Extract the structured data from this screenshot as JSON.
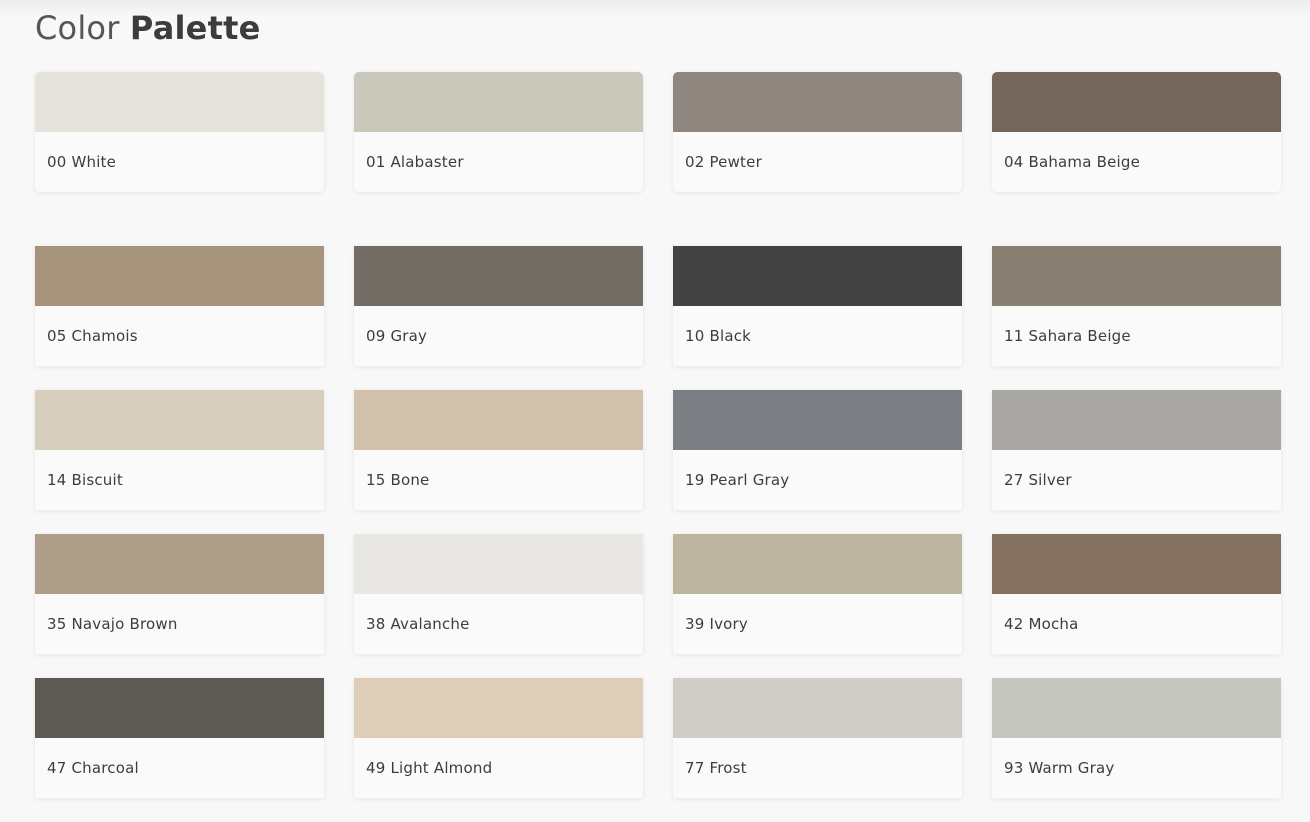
{
  "header": {
    "title_light": "Color",
    "title_bold": "Palette"
  },
  "colors": [
    {
      "label": "00 White",
      "hex": "#e5e3dc"
    },
    {
      "label": "01 Alabaster",
      "hex": "#cac8bb"
    },
    {
      "label": "02 Pewter",
      "hex": "#8f8680"
    },
    {
      "label": "04 Bahama Beige",
      "hex": "#74665b"
    },
    {
      "label": "05 Chamois",
      "hex": "#a6937b"
    },
    {
      "label": "09 Gray",
      "hex": "#736d66"
    },
    {
      "label": "10 Black",
      "hex": "#434343"
    },
    {
      "label": "11 Sahara Beige",
      "hex": "#897e72"
    },
    {
      "label": "14 Biscuit",
      "hex": "#d7cebd"
    },
    {
      "label": "15 Bone",
      "hex": "#d2c2ad"
    },
    {
      "label": "19 Pearl Gray",
      "hex": "#7b7f83"
    },
    {
      "label": "27 Silver",
      "hex": "#a8a7a3"
    },
    {
      "label": "35 Navajo Brown",
      "hex": "#ae9e89"
    },
    {
      "label": "38 Avalanche",
      "hex": "#e8e7e3"
    },
    {
      "label": "39 Ivory",
      "hex": "#bdb49f"
    },
    {
      "label": "42 Mocha",
      "hex": "#857160"
    },
    {
      "label": "47 Charcoal",
      "hex": "#5d5953"
    },
    {
      "label": "49 Light Almond",
      "hex": "#ddcdb9"
    },
    {
      "label": "77 Frost",
      "hex": "#d0ccc6"
    },
    {
      "label": "93 Warm Gray",
      "hex": "#c6c6c0"
    }
  ]
}
